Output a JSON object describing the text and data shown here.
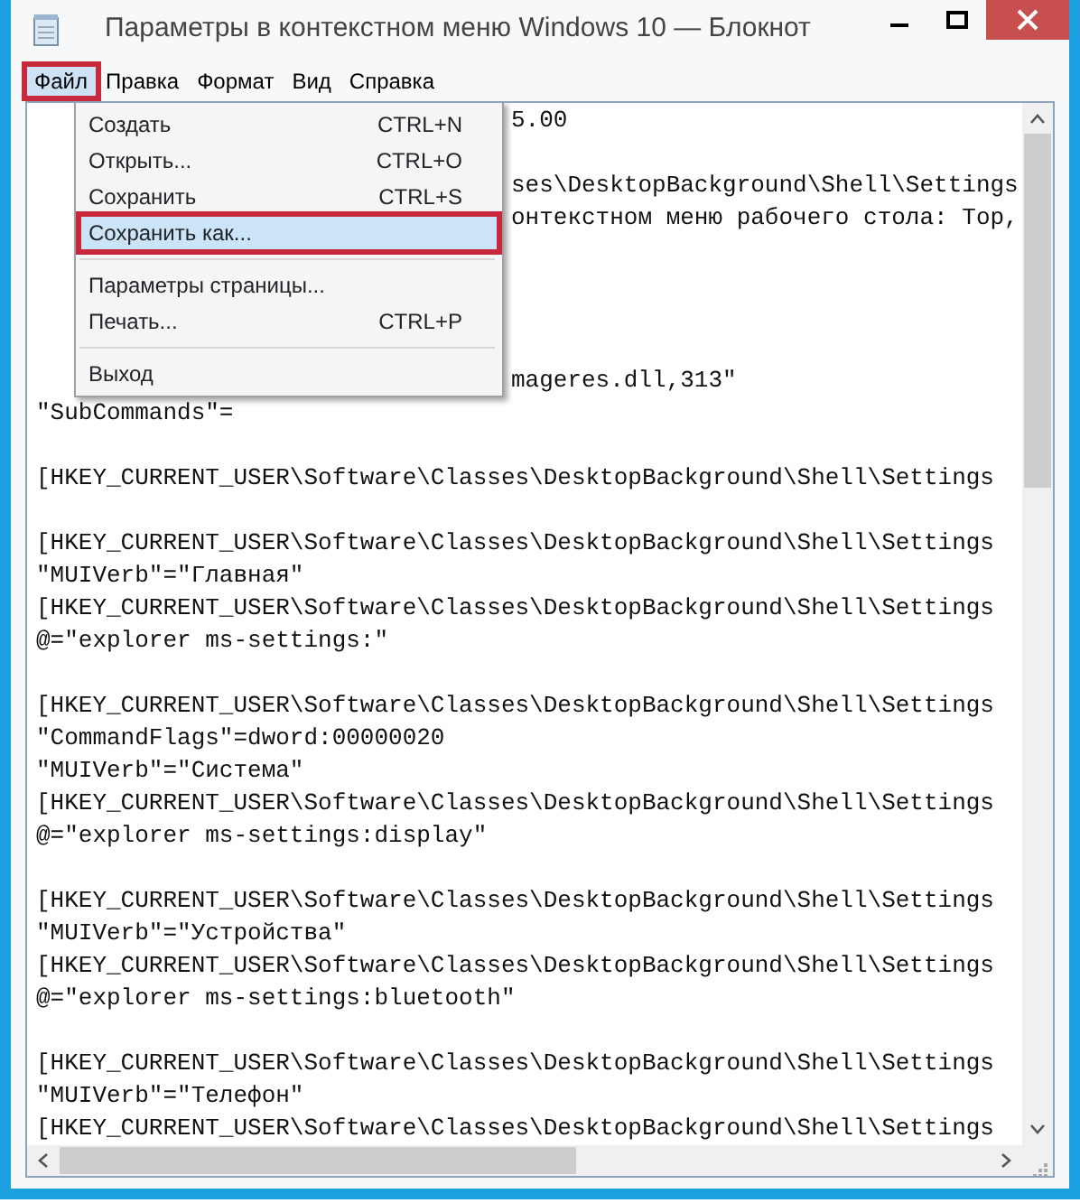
{
  "window": {
    "title": "Параметры в контекстном меню Windows 10 — Блокнот"
  },
  "menubar": [
    {
      "label": "Файл",
      "selected": true,
      "annotated": true
    },
    {
      "label": "Правка",
      "selected": false,
      "annotated": false
    },
    {
      "label": "Формат",
      "selected": false,
      "annotated": false
    },
    {
      "label": "Вид",
      "selected": false,
      "annotated": false
    },
    {
      "label": "Справка",
      "selected": false,
      "annotated": false
    }
  ],
  "file_menu": [
    {
      "kind": "item",
      "label": "Создать",
      "shortcut": "CTRL+N",
      "selected": false,
      "annotated": false
    },
    {
      "kind": "item",
      "label": "Открыть...",
      "shortcut": "CTRL+O",
      "selected": false,
      "annotated": false
    },
    {
      "kind": "item",
      "label": "Сохранить",
      "shortcut": "CTRL+S",
      "selected": false,
      "annotated": false
    },
    {
      "kind": "item",
      "label": "Сохранить как...",
      "selected": true,
      "annotated": true
    },
    {
      "kind": "separator"
    },
    {
      "kind": "item",
      "label": "Параметры страницы...",
      "selected": false,
      "annotated": false
    },
    {
      "kind": "item",
      "label": "Печать...",
      "shortcut": "CTRL+P",
      "selected": false,
      "annotated": false
    },
    {
      "kind": "separator"
    },
    {
      "kind": "item",
      "label": "Выход",
      "selected": false,
      "annotated": false
    }
  ],
  "editor_lines": [
    {
      "kind": "covered",
      "text": "5.00"
    },
    {
      "kind": "blank"
    },
    {
      "kind": "covered",
      "text": "ses\\DesktopBackground\\Shell\\Settings"
    },
    {
      "kind": "covered",
      "text": "онтекстном меню рабочего стола: Top,"
    },
    {
      "kind": "blank"
    },
    {
      "kind": "blank"
    },
    {
      "kind": "blank"
    },
    {
      "kind": "blank"
    },
    {
      "kind": "covered",
      "text": "mageres.dll,313\""
    },
    {
      "kind": "text",
      "text": "\"SubCommands\"="
    },
    {
      "kind": "blank"
    },
    {
      "kind": "text",
      "text": "[HKEY_CURRENT_USER\\Software\\Classes\\DesktopBackground\\Shell\\Settings"
    },
    {
      "kind": "blank"
    },
    {
      "kind": "text",
      "text": "[HKEY_CURRENT_USER\\Software\\Classes\\DesktopBackground\\Shell\\Settings"
    },
    {
      "kind": "text",
      "text": "\"MUIVerb\"=\"Главная\""
    },
    {
      "kind": "text",
      "text": "[HKEY_CURRENT_USER\\Software\\Classes\\DesktopBackground\\Shell\\Settings"
    },
    {
      "kind": "text",
      "text": "@=\"explorer ms-settings:\""
    },
    {
      "kind": "blank"
    },
    {
      "kind": "text",
      "text": "[HKEY_CURRENT_USER\\Software\\Classes\\DesktopBackground\\Shell\\Settings"
    },
    {
      "kind": "text",
      "text": "\"CommandFlags\"=dword:00000020"
    },
    {
      "kind": "text",
      "text": "\"MUIVerb\"=\"Система\""
    },
    {
      "kind": "text",
      "text": "[HKEY_CURRENT_USER\\Software\\Classes\\DesktopBackground\\Shell\\Settings"
    },
    {
      "kind": "text",
      "text": "@=\"explorer ms-settings:display\""
    },
    {
      "kind": "blank"
    },
    {
      "kind": "text",
      "text": "[HKEY_CURRENT_USER\\Software\\Classes\\DesktopBackground\\Shell\\Settings"
    },
    {
      "kind": "text",
      "text": "\"MUIVerb\"=\"Устройства\""
    },
    {
      "kind": "text",
      "text": "[HKEY_CURRENT_USER\\Software\\Classes\\DesktopBackground\\Shell\\Settings"
    },
    {
      "kind": "text",
      "text": "@=\"explorer ms-settings:bluetooth\""
    },
    {
      "kind": "blank"
    },
    {
      "kind": "text",
      "text": "[HKEY_CURRENT_USER\\Software\\Classes\\DesktopBackground\\Shell\\Settings"
    },
    {
      "kind": "text",
      "text": "\"MUIVerb\"=\"Телефон\""
    },
    {
      "kind": "text",
      "text": "[HKEY_CURRENT_USER\\Software\\Classes\\DesktopBackground\\Shell\\Settings"
    }
  ]
}
